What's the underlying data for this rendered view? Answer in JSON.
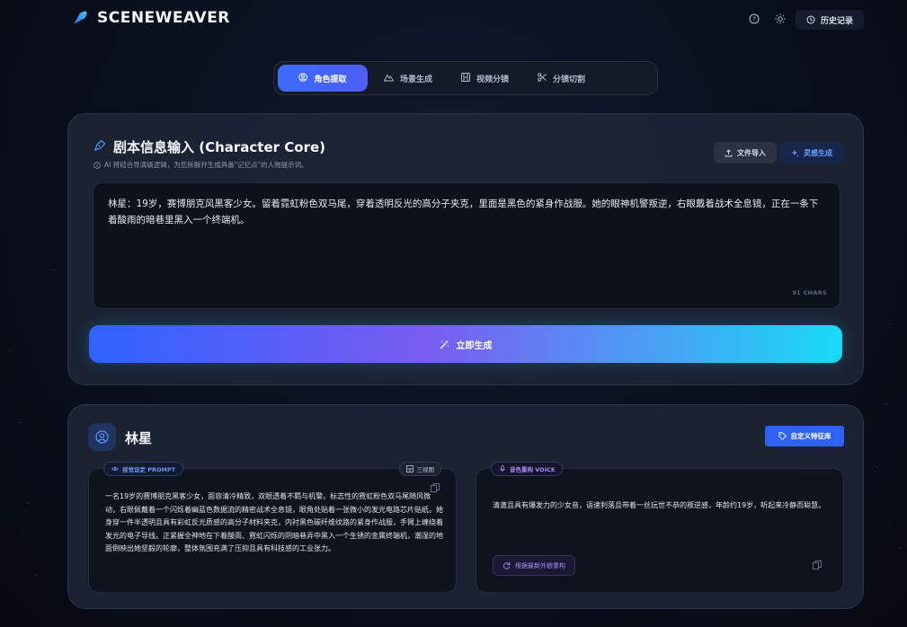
{
  "header": {
    "brand": "SCENEWEAVER",
    "help_icon": "help-circle-icon",
    "theme_icon": "sun-icon",
    "history_label": "历史记录"
  },
  "tabs": [
    {
      "label": "角色提取",
      "icon": "user-circle-icon",
      "active": true
    },
    {
      "label": "场景生成",
      "icon": "mountain-icon",
      "active": false
    },
    {
      "label": "视频分镜",
      "icon": "film-icon",
      "active": false
    },
    {
      "label": "分镜切割",
      "icon": "scissors-icon",
      "active": false
    }
  ],
  "input_card": {
    "title": "剧本信息输入 (Character Core)",
    "subtitle": "AI 将结合导演级逻辑，为您拆解并生成具备\"记忆点\"的人物提示词。",
    "import_label": "文件导入",
    "inspire_label": "灵感生成",
    "script_text": "林星：19岁，赛博朋克风黑客少女。留着霓虹粉色双马尾，穿着透明反光的高分子夹克，里面是黑色的紧身作战服。她的眼神机警叛逆，右眼戴着战术全息镜，正在一条下着酸雨的暗巷里黑入一个终端机。",
    "char_count": "91 CHARS",
    "generate_label": "立即生成"
  },
  "character_card": {
    "name": "林星",
    "library_label": "自定义特征库",
    "prompt_pill": "视觉设定 PROMPT",
    "view_pill": "三视图",
    "prompt_text": "一名19岁的赛博朋克黑客少女，面容清冷精致，双眼透着不羁与机警。标志性的霓虹粉色双马尾随风微动，右眼佩戴着一个闪烁着幽蓝色数据流的精密战术全息镜，眼角处贴着一张微小的发光电路芯片贴纸。她身穿一件半透明且具有彩虹反光质感的高分子材料夹克，内衬黑色碳纤维纹路的紧身作战服，手臂上缠绕着发光的电子导线。正紧握全神地在下着酸雨、霓虹闪烁的阴暗巷弄中黑入一个生锈的金属终端机，潮湿的地面倒映出她坚毅的轮廓，整体氛围充满了压抑且具有科技感的工业张力。",
    "voice_pill": "音色重构 VOICE",
    "voice_text": "清澈且具有爆发力的少女音，语速利落且带着一丝玩世不恭的叛逆感，年龄约19岁，听起来冷静而聪慧。",
    "rebuild_label": "根据最新外貌重构"
  },
  "colors": {
    "accent": "#3b6bff",
    "gradient_end": "#17dbf5",
    "voice_accent": "#a98cf0"
  }
}
